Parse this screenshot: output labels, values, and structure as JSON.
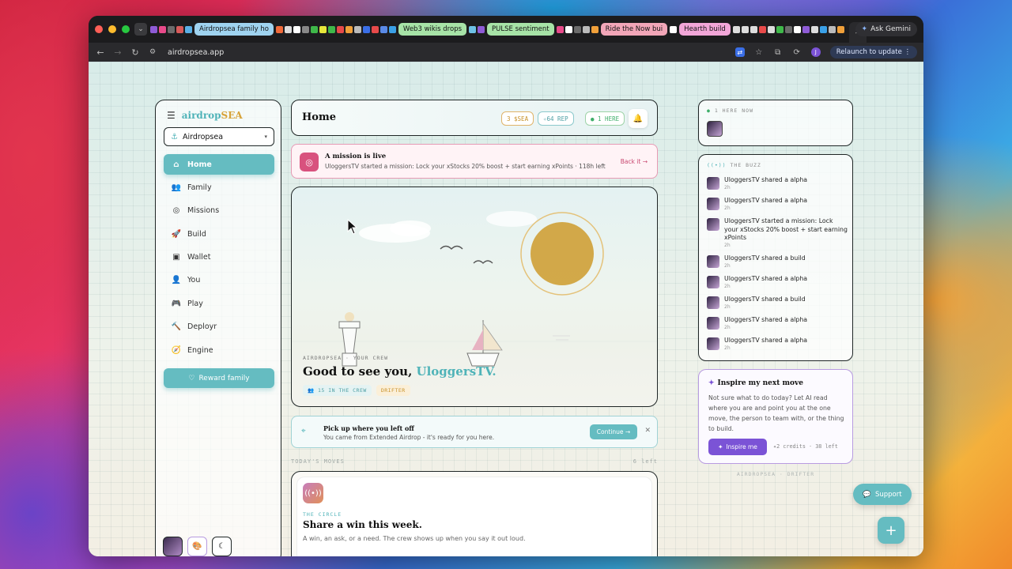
{
  "browser": {
    "tabs": [
      {
        "label": "Airdropsea family ho",
        "color": "#9fd3f0"
      },
      {
        "label": "Web3 wikis drops",
        "color": "#a7e3a7"
      },
      {
        "label": "PULSE sentiment",
        "color": "#a7e3a7"
      },
      {
        "label": "Ride the Now bui",
        "color": "#f2a6b8"
      },
      {
        "label": "Hearth build",
        "color": "#f2a6d8"
      }
    ],
    "ask_gemini": "Ask Gemini",
    "url": "airdropsea.app",
    "relaunch": "Relaunch to update",
    "profile_initial": "J"
  },
  "sidebar": {
    "brand_a": "airdrop",
    "brand_b": "SEA",
    "family_select": "Airdropsea",
    "items": [
      {
        "label": "Home",
        "icon": "home-icon",
        "glyph": "⌂"
      },
      {
        "label": "Family",
        "icon": "users-icon",
        "glyph": "👥"
      },
      {
        "label": "Missions",
        "icon": "target-icon",
        "glyph": "◎"
      },
      {
        "label": "Build",
        "icon": "rocket-icon",
        "glyph": "🚀"
      },
      {
        "label": "Wallet",
        "icon": "wallet-icon",
        "glyph": "▣"
      },
      {
        "label": "You",
        "icon": "user-icon",
        "glyph": "👤"
      },
      {
        "label": "Play",
        "icon": "gamepad-icon",
        "glyph": "🎮"
      },
      {
        "label": "Deployr",
        "icon": "hammer-icon",
        "glyph": "🔨"
      },
      {
        "label": "Engine",
        "icon": "compass-icon",
        "glyph": "🧭"
      }
    ],
    "reward_label": "Reward family"
  },
  "header": {
    "title": "Home",
    "chip_sea": "3 $SEA",
    "chip_rep": "✧64 REP",
    "chip_here": "● 1 HERE"
  },
  "mission": {
    "title": "A mission is live",
    "subtitle": "UloggersTV started a mission: Lock your xStocks 20% boost + start earning xPoints · 118h left",
    "action": "Back it"
  },
  "hero": {
    "eyebrow": "AIRDROPSEA · YOUR CREW",
    "greeting": "Good to see you, ",
    "name": "UloggersTV.",
    "crew_tag": "15 IN THE CREW",
    "rank_tag": "DRIFTER"
  },
  "pickup": {
    "title": "Pick up where you left off",
    "subtitle": "You came from Extended Airdrop - it's ready for you here.",
    "action": "Continue"
  },
  "moves": {
    "label": "TODAY'S MOVES",
    "left": "6 left"
  },
  "circle": {
    "eyebrow": "THE CIRCLE",
    "title": "Share a win this week.",
    "subtitle": "A win, an ask, or a need. The crew shows up when you say it out loud."
  },
  "here_now": {
    "label": "1 HERE NOW"
  },
  "buzz": {
    "label": "THE BUZZ",
    "items": [
      {
        "text": "UloggersTV shared a alpha",
        "time": "2h"
      },
      {
        "text": "UloggersTV shared a alpha",
        "time": "2h"
      },
      {
        "text": "UloggersTV started a mission: Lock your xStocks 20% boost + start earning xPoints",
        "time": "2h"
      },
      {
        "text": "UloggersTV shared a build",
        "time": "2h"
      },
      {
        "text": "UloggersTV shared a alpha",
        "time": "2h"
      },
      {
        "text": "UloggersTV shared a build",
        "time": "2h"
      },
      {
        "text": "UloggersTV shared a alpha",
        "time": "2h"
      },
      {
        "text": "UloggersTV shared a alpha",
        "time": "2h"
      }
    ]
  },
  "inspire": {
    "title": "Inspire my next move",
    "body": "Not sure what to do today? Let AI read where you are and point you at the one move, the person to team with, or the thing to build.",
    "button": "Inspire me",
    "credits": "✦2 credits · 38 left"
  },
  "footer_tag": "AIRDROPSEA · DRIFTER",
  "support": "Support",
  "colors": {
    "accent": "#65bcc1",
    "mission": "#d8527e",
    "ai": "#7b53d6",
    "gold": "#d7a33a"
  }
}
